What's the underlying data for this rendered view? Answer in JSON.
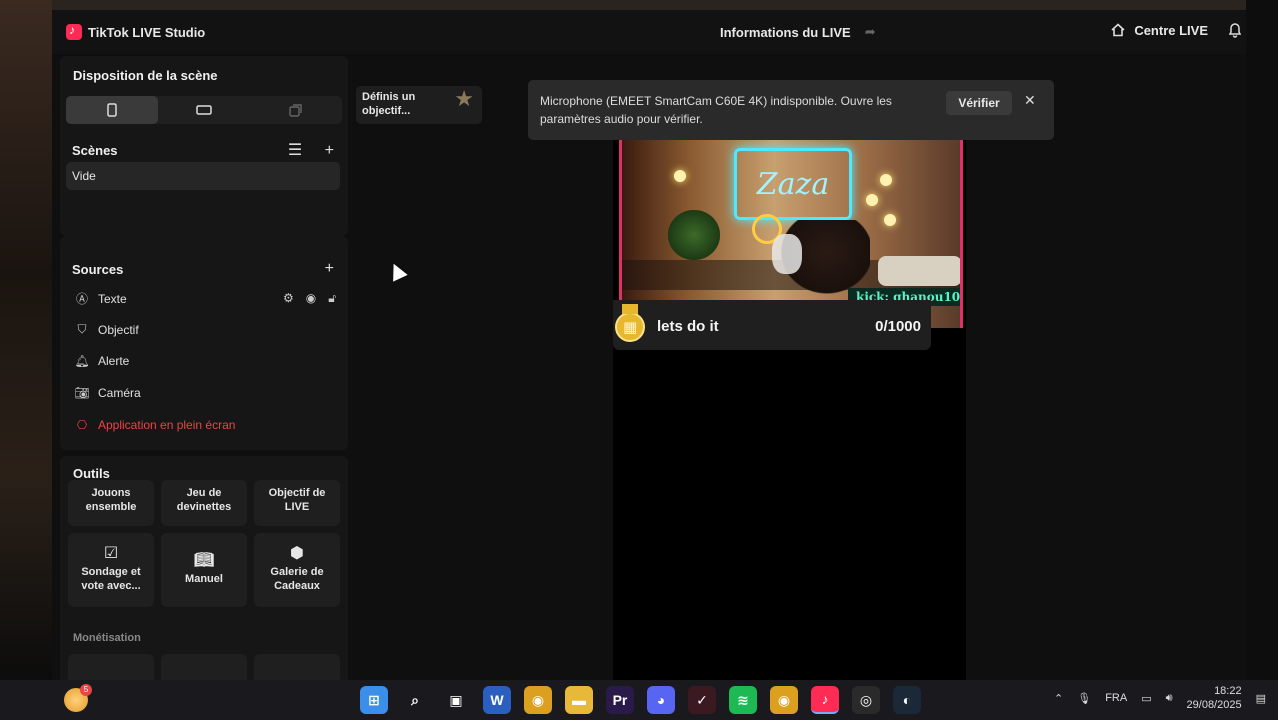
{
  "window": {
    "app_name": "TikTok LIVE Studio",
    "live_info": "Informations du LIVE",
    "live_center": "Centre LIVE"
  },
  "scene_layout": {
    "title": "Disposition de la scène",
    "orientations": [
      "portrait",
      "landscape",
      "dual"
    ]
  },
  "scenes": {
    "title": "Scènes",
    "items": [
      "Vide"
    ]
  },
  "sources": {
    "title": "Sources",
    "items": [
      {
        "label": "Texte",
        "icon": "text-icon"
      },
      {
        "label": "Objectif",
        "icon": "shield-icon"
      },
      {
        "label": "Alerte",
        "icon": "bell-icon"
      },
      {
        "label": "Caméra",
        "icon": "camera-icon"
      },
      {
        "label": "Application en plein écran",
        "icon": "gamepad-icon",
        "status": "error",
        "color": "#e84545"
      }
    ]
  },
  "tools": {
    "title": "Outils",
    "items": [
      {
        "label": "Jouons ensemble"
      },
      {
        "label": "Jeu de devinettes"
      },
      {
        "label": "Objectif de LIVE"
      },
      {
        "label": "Sondage et vote avec...",
        "icon": "poll-icon"
      },
      {
        "label": "Manuel",
        "icon": "book-icon"
      },
      {
        "label": "Galerie de Cadeaux",
        "icon": "gift-gallery-icon"
      }
    ],
    "monetization_title": "Monétisation"
  },
  "goal_chip": {
    "label": "Définis un objectif..."
  },
  "notification": {
    "message": "Microphone (EMEET SmartCam C60E 4K) indisponible. Ouvre les paramètres audio pour vérifier.",
    "action": "Vérifier"
  },
  "preview": {
    "kick_tag": "kick: ghanou10",
    "goal_label": "lets do it",
    "goal_count": "0/1000"
  },
  "taskbar": {
    "weather_badge": "5",
    "language": "FRA",
    "time": "18:22",
    "date": "29/08/2025",
    "apps": [
      {
        "name": "windows-start",
        "color": "#3b8eea"
      },
      {
        "name": "search",
        "color": "#1a1a1e"
      },
      {
        "name": "task-view",
        "color": "#1a1a1e"
      },
      {
        "name": "word",
        "color": "#2b5fbf"
      },
      {
        "name": "chrome",
        "color": "#dba020"
      },
      {
        "name": "file-explorer",
        "color": "#e8b83a"
      },
      {
        "name": "premiere",
        "color": "#2a1a4a"
      },
      {
        "name": "discord",
        "color": "#5865f2"
      },
      {
        "name": "app-red",
        "color": "#3a1a20"
      },
      {
        "name": "spotify",
        "color": "#1db954"
      },
      {
        "name": "chrome-2",
        "color": "#dba020"
      },
      {
        "name": "tiktok",
        "color": "#fe2c55"
      },
      {
        "name": "obs",
        "color": "#2a2a2a"
      },
      {
        "name": "steam",
        "color": "#1b2838"
      }
    ]
  },
  "colors": {
    "accent": "#fe2c55",
    "error": "#e84545",
    "panel": "#161616"
  }
}
